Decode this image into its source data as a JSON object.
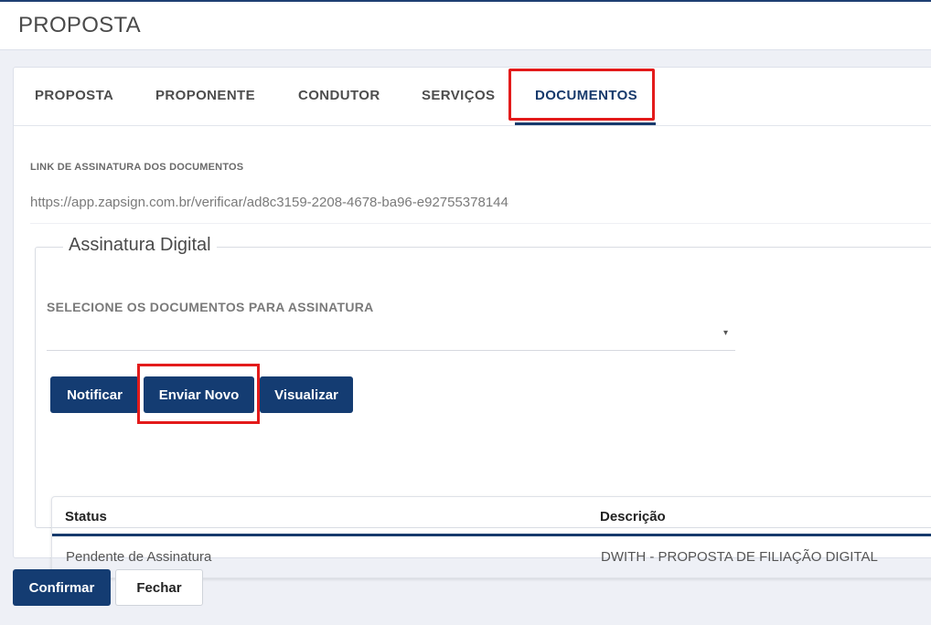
{
  "header": {
    "title": "PROPOSTA"
  },
  "tabs": [
    {
      "label": "PROPOSTA"
    },
    {
      "label": "PROPONENTE"
    },
    {
      "label": "CONDUTOR"
    },
    {
      "label": "SERVIÇOS"
    },
    {
      "label": "DOCUMENTOS",
      "active": true
    }
  ],
  "link_section": {
    "label": "LINK DE ASSINATURA DOS DOCUMENTOS",
    "value": "https://app.zapsign.com.br/verificar/ad8c3159-2208-4678-ba96-e92755378144"
  },
  "signature": {
    "legend": "Assinatura Digital",
    "select_label": "SELECIONE OS DOCUMENTOS PARA ASSINATURA",
    "select_value": "",
    "buttons": {
      "notify": "Notificar",
      "send_new": "Enviar Novo",
      "view": "Visualizar"
    },
    "table": {
      "columns": [
        "Status",
        "Descrição"
      ],
      "rows": [
        [
          "Pendente de Assinatura",
          "DWITH - PROPOSTA DE FILIAÇÃO DIGITAL"
        ]
      ]
    }
  },
  "footer": {
    "confirm": "Confirmar",
    "close": "Fechar"
  },
  "colors": {
    "primary": "#143c72",
    "highlight": "#e31b1b"
  },
  "icons": {
    "select_caret": "▾"
  }
}
